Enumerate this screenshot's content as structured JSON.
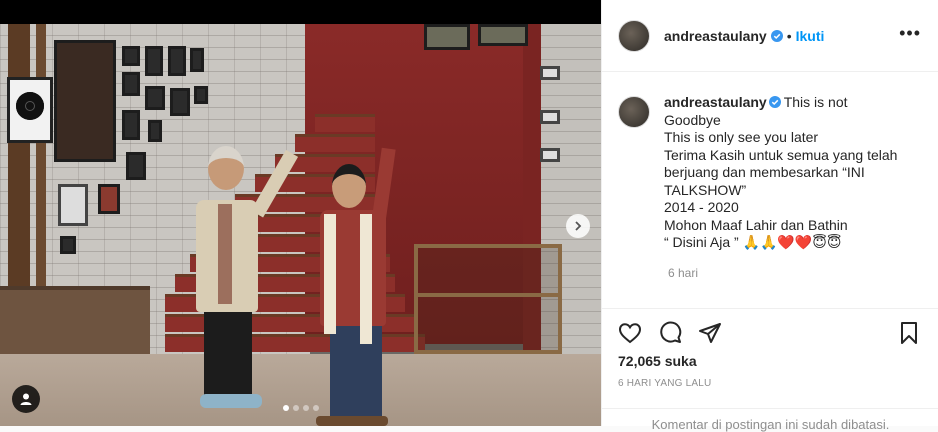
{
  "post": {
    "author": "andreastaulany",
    "follow_label": "Ikuti",
    "separator": "•",
    "more_label": "•••",
    "caption": "This is not\nGoodbye\nThis is only see you later\nTerima Kasih untuk semua yang telah berjuang dan membesarkan “INI TALKSHOW”\n2014 - 2020\nMohon Maaf Lahir dan Bathin\n“ Disini Aja ” 🙏🙏❤️❤️😇😇",
    "time_ago": "6 hari",
    "likes": "72,065 suka",
    "posted_label": "6 HARI YANG LALU",
    "comments_disabled": "Komentar di postingan ini sudah dibatasi."
  },
  "media": {
    "carousel_total": 4,
    "carousel_current": 1
  },
  "icons": {
    "verified": "verified-badge-icon",
    "like": "heart-icon",
    "comment": "comment-bubble-icon",
    "share": "paper-plane-icon",
    "save": "bookmark-icon",
    "next": "chevron-right-icon",
    "tag": "user-tag-icon"
  },
  "colors": {
    "accent": "#0095f6",
    "text": "#262626",
    "muted": "#8e8e8e",
    "border": "#efefef"
  }
}
